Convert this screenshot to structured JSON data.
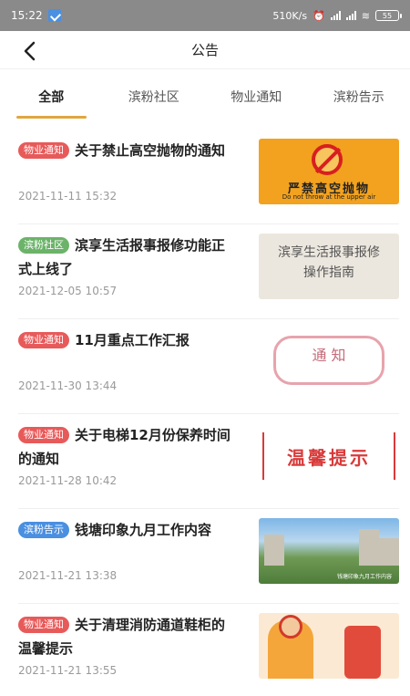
{
  "status_bar": {
    "time": "15:22",
    "network_speed": "510K/s",
    "battery": "55"
  },
  "nav": {
    "title": "公告",
    "back_icon": "chevron-left-icon"
  },
  "tabs": [
    {
      "label": "全部",
      "active": true
    },
    {
      "label": "滨粉社区",
      "active": false
    },
    {
      "label": "物业通知",
      "active": false
    },
    {
      "label": "滨粉告示",
      "active": false
    }
  ],
  "tag_colors": {
    "物业通知": "#e85a5a",
    "滨粉社区": "#6cb36a",
    "滨粉告示": "#4a8fe0"
  },
  "items": [
    {
      "tag": "物业通知",
      "title": "关于禁止高空抛物的通知",
      "date": "2021-11-11 15:32",
      "thumb": {
        "main": "严禁高空抛物",
        "sub": "Do not throw at the upper air"
      }
    },
    {
      "tag": "滨粉社区",
      "title": "滨享生活报事报修功能正式上线了",
      "date": "2021-12-05 10:57",
      "thumb": {
        "line1": "滨享生活报事报修",
        "line2": "操作指南"
      }
    },
    {
      "tag": "物业通知",
      "title": "11月重点工作汇报",
      "date": "2021-11-30 13:44",
      "thumb": {
        "main": "通 知"
      }
    },
    {
      "tag": "物业通知",
      "title": "关于电梯12月份保养时间的通知",
      "date": "2021-11-28 10:42",
      "thumb": {
        "main": "温馨提示"
      }
    },
    {
      "tag": "滨粉告示",
      "title": "钱塘印象九月工作内容",
      "date": "2021-11-21 13:38",
      "thumb": {
        "caption": "钱塘印象九月工作内容"
      }
    },
    {
      "tag": "物业通知",
      "title": "关于清理消防通道鞋柜的温馨提示",
      "date": "2021-11-21 13:55",
      "thumb": {}
    }
  ]
}
